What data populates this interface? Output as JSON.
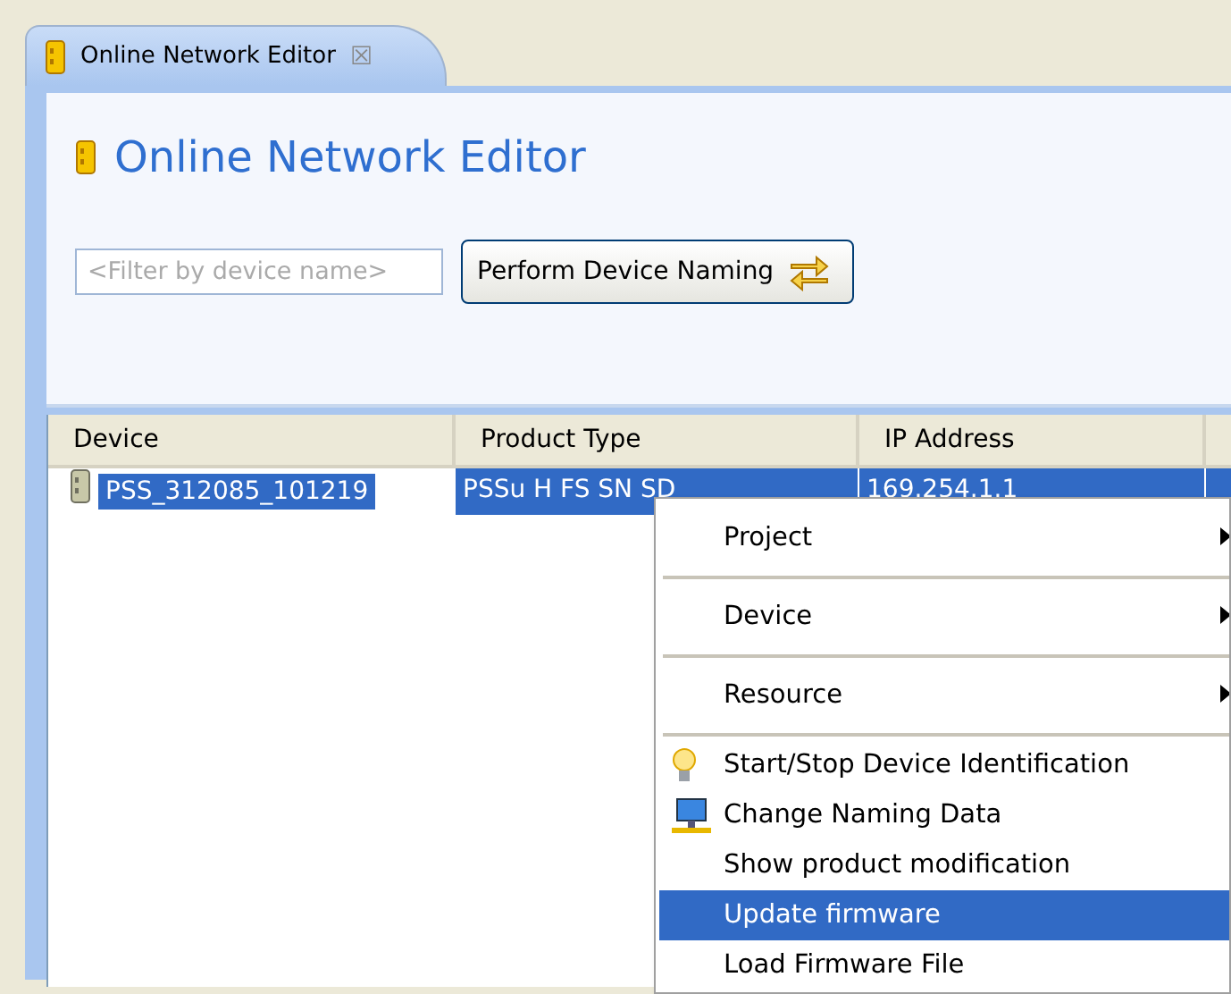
{
  "tab": {
    "title": "Online Network Editor",
    "close": "☒"
  },
  "editor": {
    "title": "Online Network Editor",
    "filter": {
      "placeholder": "<Filter by device name>"
    },
    "naming_button": "Perform Device Naming"
  },
  "table": {
    "columns": [
      "Device",
      "Product Type",
      "IP Address"
    ],
    "rows": [
      {
        "device": "PSS_312085_101219",
        "product_type": "PSSu H FS SN SD",
        "ip_address": "169.254.1.1",
        "selected": true
      }
    ]
  },
  "context_menu": [
    {
      "label": "Project",
      "kind": "submenu",
      "selected": false
    },
    {
      "label": "Device",
      "kind": "submenu",
      "selected": false
    },
    {
      "label": "Resource",
      "kind": "submenu",
      "selected": false
    },
    {
      "label": "Start/Stop Device Identification",
      "kind": "bulb",
      "selected": false
    },
    {
      "label": "Change Naming Data",
      "kind": "computer",
      "selected": false
    },
    {
      "label": "Show product modification",
      "kind": "plain",
      "selected": false
    },
    {
      "label": "Update firmware",
      "kind": "plain",
      "selected": true
    },
    {
      "label": "Load Firmware File",
      "kind": "plain",
      "selected": false
    }
  ]
}
